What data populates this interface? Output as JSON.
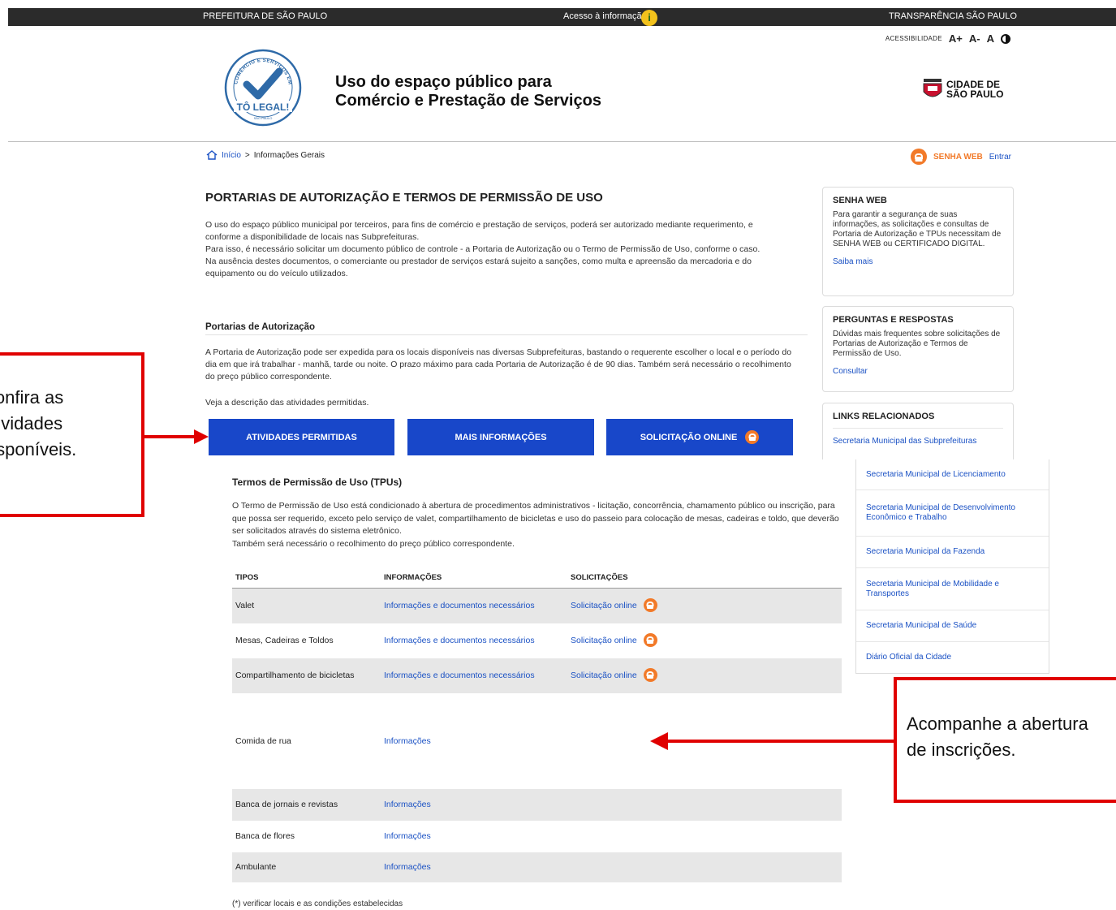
{
  "topbar": {
    "left": "PREFEITURA DE SÃO PAULO",
    "center": "Acesso à informação",
    "center_badge": "i",
    "right": "TRANSPARÊNCIA SÃO PAULO"
  },
  "accessibility": {
    "label": "ACESSIBILIDADE",
    "increase": "A+",
    "decrease": "A-",
    "normal": "A"
  },
  "header": {
    "logo_text": "TÔ LEGAL!",
    "logo_ring_text": "COMÉRCIO E SERVIÇOS EM VIAS PÚBLICAS",
    "logo_sub": "SÃO PAULO",
    "title_line1": "Uso do espaço público para",
    "title_line2": "Comércio e Prestação de Serviços",
    "city_logo_line1": "CIDADE DE",
    "city_logo_line2": "SÃO PAULO"
  },
  "breadcrumb": {
    "home": "Início",
    "separator": ">",
    "current": "Informações Gerais"
  },
  "login": {
    "senha_label": "SENHA WEB",
    "entrar": "Entrar"
  },
  "main": {
    "title": "PORTARIAS DE AUTORIZAÇÃO E TERMOS DE PERMISSÃO DE USO",
    "intro_p1": "O uso do espaço público municipal por terceiros, para fins de comércio e prestação de serviços, poderá ser autorizado mediante requerimento, e conforme a disponibilidade de locais nas Subprefeituras.",
    "intro_p2": "Para isso, é necessário solicitar um documento público de controle - a Portaria de Autorização ou o Termo de Permissão de Uso, conforme o caso.",
    "intro_p3": "Na ausência destes documentos, o comerciante ou prestador de serviços estará sujeito a sanções, como multa e apreensão da mercadoria e do equipamento ou do veículo utilizados.",
    "portarias_title": "Portarias de Autorização",
    "portarias_text": "A Portaria de Autorização pode ser expedida para os locais disponíveis nas diversas Subprefeituras, bastando o requerente escolher o local e o período do dia em que irá trabalhar - manhã, tarde ou noite.   O prazo máximo para cada Portaria de Autorização é de 90 dias. Também será necessário o recolhimento do preço público correspondente.",
    "veja": "Veja a descrição das atividades permitidas.",
    "buttons": {
      "atividades": "ATIVIDADES PERMITIDAS",
      "mais_info": "MAIS INFORMAÇÕES",
      "solicitacao": "SOLICITAÇÃO ONLINE"
    },
    "tpu_title": "Termos de Permissão de Uso (TPUs)",
    "tpu_text_p1": "O Termo de Permissão de Uso está condicionado à abertura de procedimentos administrativos - licitação, concorrência, chamamento público ou inscrição, para que possa ser requerido, exceto pelo serviço de valet, compartilhamento de bicicletas e uso do passeio para colocação de mesas, cadeiras e toldo, que deverão ser solicitados através do sistema eletrônico.",
    "tpu_text_p2": "Também será necessário o recolhimento do preço público correspondente.",
    "table": {
      "headers": [
        "TIPOS",
        "INFORMAÇÕES",
        "SOLICITAÇÕES"
      ],
      "rows": [
        {
          "tipo": "Valet",
          "info": "Informações e documentos necessários",
          "sol": "Solicitação online"
        },
        {
          "tipo": "Mesas, Cadeiras e Toldos",
          "info": "Informações e documentos necessários",
          "sol": "Solicitação online"
        },
        {
          "tipo": "Compartilhamento de bicicletas",
          "info": "Informações e documentos necessários",
          "sol": "Solicitação online"
        },
        {
          "tipo": "Comida de rua",
          "info": "Informações",
          "sol": ""
        },
        {
          "tipo": "Banca de jornais e revistas",
          "info": "Informações",
          "sol": ""
        },
        {
          "tipo": "Banca de flores",
          "info": "Informações",
          "sol": ""
        },
        {
          "tipo": "Ambulante",
          "info": "Informações",
          "sol": ""
        }
      ]
    },
    "footnote": "(*) verificar locais e as condições estabelecidas"
  },
  "sidebar": {
    "senha": {
      "title": "SENHA WEB",
      "text": "Para garantir a segurança de suas informações, as solicitações e consultas de Portaria de Autorização e TPUs necessitam de SENHA WEB ou CERTIFICADO DIGITAL.",
      "link": "Saiba mais"
    },
    "perguntas": {
      "title": "PERGUNTAS E RESPOSTAS",
      "text": "Dúvidas mais frequentes sobre solicitações de Portarias de Autorização e Termos de Permissão de Uso.",
      "link": "Consultar"
    },
    "links": {
      "title": "LINKS RELACIONADOS",
      "first": "Secretaria Municipal das Subprefeituras",
      "items": [
        "Secretaria Municipal de Licenciamento",
        "Secretaria Municipal de Desenvolvimento Econômico e Trabalho",
        "Secretaria Municipal da Fazenda",
        "Secretaria Municipal de Mobilidade e Transportes",
        "Secretaria Municipal de Saúde",
        "Diário Oficial da Cidade"
      ]
    }
  },
  "callouts": {
    "left_line1": "Confira as",
    "left_line2": "atividades",
    "left_line3": "disponíveis.",
    "right_line1": "Acompanhe a abertura",
    "right_line2": "de inscrições."
  },
  "colors": {
    "primary_button": "#1847c9",
    "link": "#1a51c4",
    "lock_accent": "#f27a29",
    "callout_border": "#e00000",
    "topbar": "#2b2b2b"
  }
}
